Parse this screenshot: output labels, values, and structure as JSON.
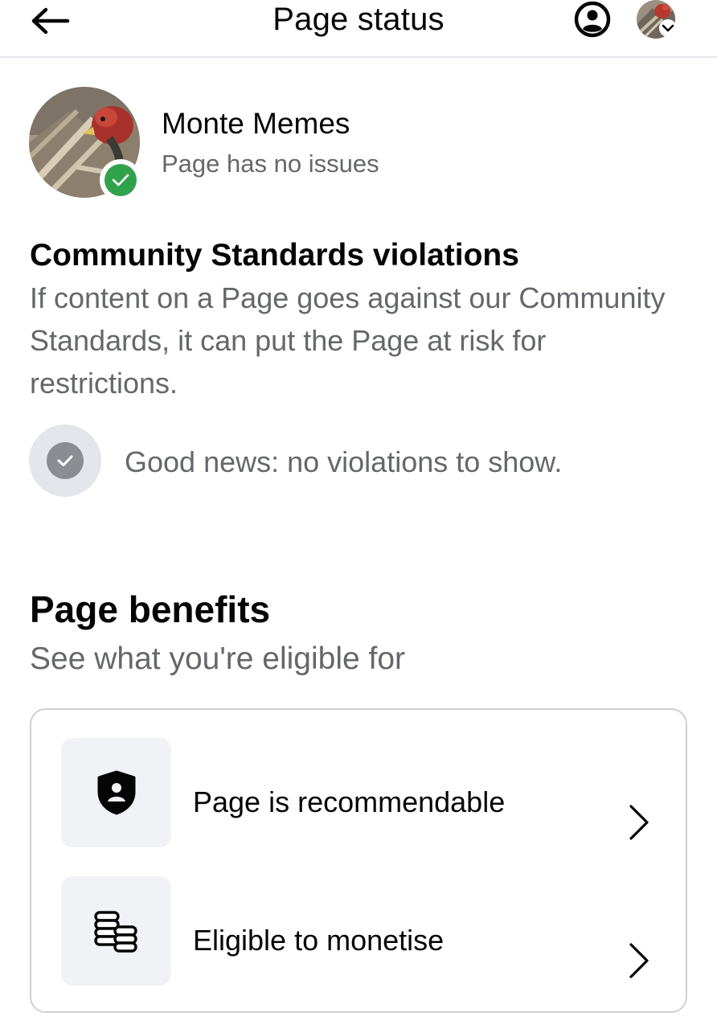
{
  "header": {
    "title": "Page status",
    "back_icon": "arrow-left-icon",
    "profile_icon": "user-circle-icon"
  },
  "page": {
    "name": "Monte Memes",
    "status": "Page has no issues",
    "badge_icon": "check-circle-icon",
    "badge_color": "#31a24c"
  },
  "community_standards": {
    "heading": "Community Standards violations",
    "description": "If content on a Page goes against our Community Standards, it can put the Page at risk for restrictions.",
    "good_news": "Good news: no violations to show.",
    "good_news_icon": "check-circle-icon"
  },
  "benefits": {
    "heading": "Page benefits",
    "subheading": "See what you're eligible for",
    "items": [
      {
        "label": "Page is recommendable",
        "icon": "shield-person-icon"
      },
      {
        "label": "Eligible to monetise",
        "icon": "coins-stack-icon"
      }
    ]
  },
  "colors": {
    "text_primary": "#050505",
    "text_secondary": "#65676b",
    "divider": "#e4e6eb",
    "icon_bg": "#f0f2f5",
    "success": "#31a24c"
  }
}
